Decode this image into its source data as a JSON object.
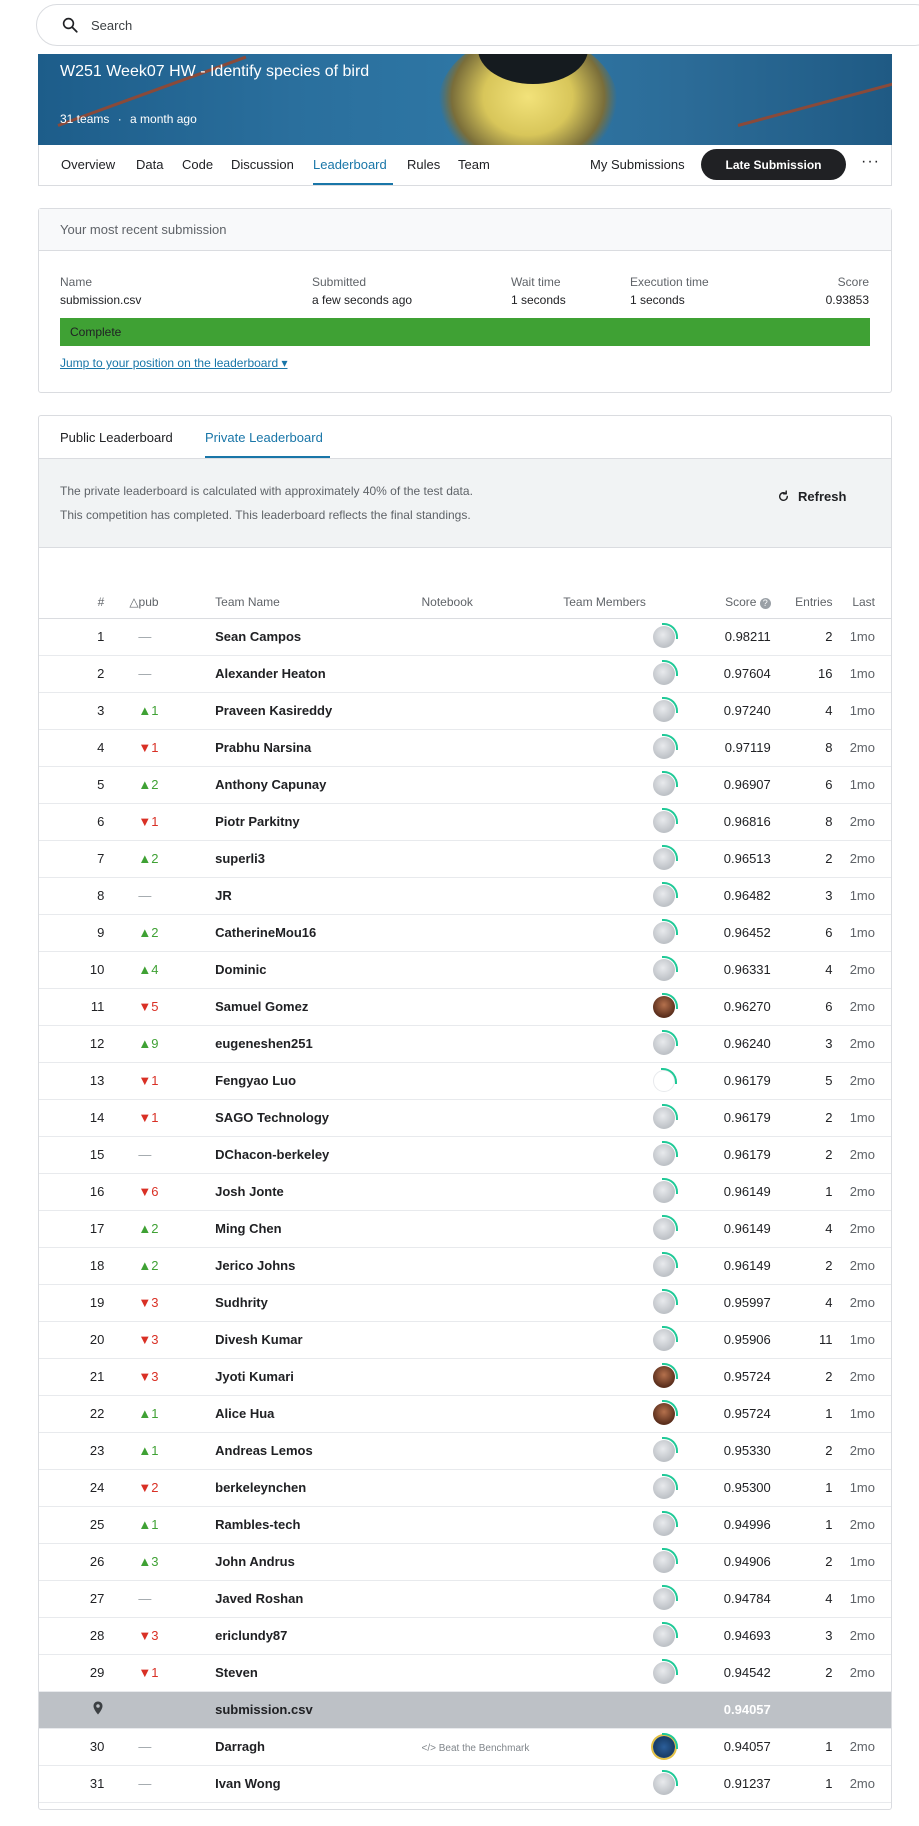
{
  "search": {
    "placeholder": "Search"
  },
  "competition": {
    "title": "W251 Week07 HW - Identify species of bird",
    "teams": "31 teams",
    "separator": "·",
    "age": "a month ago"
  },
  "nav": {
    "tabs": [
      "Overview",
      "Data",
      "Code",
      "Discussion",
      "Leaderboard",
      "Rules",
      "Team"
    ],
    "active": "Leaderboard",
    "my_submissions": "My Submissions",
    "late_submission": "Late Submission",
    "more": "···"
  },
  "submission": {
    "header": "Your most recent submission",
    "name_label": "Name",
    "name_value": "submission.csv",
    "submitted_label": "Submitted",
    "submitted_value": "a few seconds ago",
    "wait_label": "Wait time",
    "wait_value": "1 seconds",
    "exec_label": "Execution time",
    "exec_value": "1 seconds",
    "score_label": "Score",
    "score_value": "0.93853",
    "status": "Complete",
    "jump_link": "Jump to your position on the leaderboard ▾",
    "status_color": "#3fa134"
  },
  "leaderboard": {
    "tabs": [
      "Public Leaderboard",
      "Private Leaderboard"
    ],
    "active_tab": "Private Leaderboard",
    "info_line1": "The private leaderboard is calculated with approximately 40% of the test data.",
    "info_line2": "This competition has completed. This leaderboard reflects the final standings.",
    "refresh": "Refresh",
    "columns": [
      "#",
      "△pub",
      "Team Name",
      "Notebook",
      "Team Members",
      "Score",
      "Entries",
      "Last"
    ],
    "rows": [
      {
        "rank": "1",
        "dir": "flat",
        "delta": "—",
        "team": "Sean Campos",
        "score": "0.98211",
        "entries": "2",
        "last": "1mo"
      },
      {
        "rank": "2",
        "dir": "flat",
        "delta": "—",
        "team": "Alexander Heaton",
        "score": "0.97604",
        "entries": "16",
        "last": "1mo"
      },
      {
        "rank": "3",
        "dir": "up",
        "delta": "▲1",
        "team": "Praveen Kasireddy",
        "score": "0.97240",
        "entries": "4",
        "last": "1mo"
      },
      {
        "rank": "4",
        "dir": "down",
        "delta": "▼1",
        "team": "Prabhu Narsina",
        "score": "0.97119",
        "entries": "8",
        "last": "2mo"
      },
      {
        "rank": "5",
        "dir": "up",
        "delta": "▲2",
        "team": "Anthony Capunay",
        "score": "0.96907",
        "entries": "6",
        "last": "1mo"
      },
      {
        "rank": "6",
        "dir": "down",
        "delta": "▼1",
        "team": "Piotr Parkitny",
        "score": "0.96816",
        "entries": "8",
        "last": "2mo"
      },
      {
        "rank": "7",
        "dir": "up",
        "delta": "▲2",
        "team": "superli3",
        "score": "0.96513",
        "entries": "2",
        "last": "2mo"
      },
      {
        "rank": "8",
        "dir": "flat",
        "delta": "—",
        "team": "JR",
        "score": "0.96482",
        "entries": "3",
        "last": "1mo"
      },
      {
        "rank": "9",
        "dir": "up",
        "delta": "▲2",
        "team": "CatherineMou16",
        "score": "0.96452",
        "entries": "6",
        "last": "1mo"
      },
      {
        "rank": "10",
        "dir": "up",
        "delta": "▲4",
        "team": "Dominic",
        "score": "0.96331",
        "entries": "4",
        "last": "2mo"
      },
      {
        "rank": "11",
        "dir": "down",
        "delta": "▼5",
        "team": "Samuel Gomez",
        "score": "0.96270",
        "entries": "6",
        "last": "2mo",
        "avatar": "photo"
      },
      {
        "rank": "12",
        "dir": "up",
        "delta": "▲9",
        "team": "eugeneshen251",
        "score": "0.96240",
        "entries": "3",
        "last": "2mo"
      },
      {
        "rank": "13",
        "dir": "down",
        "delta": "▼1",
        "team": "Fengyao Luo",
        "score": "0.96179",
        "entries": "5",
        "last": "2mo",
        "avatar": "empty"
      },
      {
        "rank": "14",
        "dir": "down",
        "delta": "▼1",
        "team": "SAGO Technology",
        "score": "0.96179",
        "entries": "2",
        "last": "1mo"
      },
      {
        "rank": "15",
        "dir": "flat",
        "delta": "—",
        "team": "DChacon-berkeley",
        "score": "0.96179",
        "entries": "2",
        "last": "2mo"
      },
      {
        "rank": "16",
        "dir": "down",
        "delta": "▼6",
        "team": "Josh Jonte",
        "score": "0.96149",
        "entries": "1",
        "last": "2mo"
      },
      {
        "rank": "17",
        "dir": "up",
        "delta": "▲2",
        "team": "Ming Chen",
        "score": "0.96149",
        "entries": "4",
        "last": "2mo"
      },
      {
        "rank": "18",
        "dir": "up",
        "delta": "▲2",
        "team": "Jerico Johns",
        "score": "0.96149",
        "entries": "2",
        "last": "2mo"
      },
      {
        "rank": "19",
        "dir": "down",
        "delta": "▼3",
        "team": "Sudhrity",
        "score": "0.95997",
        "entries": "4",
        "last": "2mo"
      },
      {
        "rank": "20",
        "dir": "down",
        "delta": "▼3",
        "team": "Divesh Kumar",
        "score": "0.95906",
        "entries": "11",
        "last": "1mo"
      },
      {
        "rank": "21",
        "dir": "down",
        "delta": "▼3",
        "team": "Jyoti Kumari",
        "score": "0.95724",
        "entries": "2",
        "last": "2mo",
        "avatar": "photo"
      },
      {
        "rank": "22",
        "dir": "up",
        "delta": "▲1",
        "team": "Alice Hua",
        "score": "0.95724",
        "entries": "1",
        "last": "1mo",
        "avatar": "photo"
      },
      {
        "rank": "23",
        "dir": "up",
        "delta": "▲1",
        "team": "Andreas Lemos",
        "score": "0.95330",
        "entries": "2",
        "last": "2mo"
      },
      {
        "rank": "24",
        "dir": "down",
        "delta": "▼2",
        "team": "berkeleynchen",
        "score": "0.95300",
        "entries": "1",
        "last": "1mo"
      },
      {
        "rank": "25",
        "dir": "up",
        "delta": "▲1",
        "team": "Rambles-tech",
        "score": "0.94996",
        "entries": "1",
        "last": "2mo"
      },
      {
        "rank": "26",
        "dir": "up",
        "delta": "▲3",
        "team": "John Andrus",
        "score": "0.94906",
        "entries": "2",
        "last": "1mo"
      },
      {
        "rank": "27",
        "dir": "flat",
        "delta": "—",
        "team": "Javed Roshan",
        "score": "0.94784",
        "entries": "4",
        "last": "1mo"
      },
      {
        "rank": "28",
        "dir": "down",
        "delta": "▼3",
        "team": "ericlundy87",
        "score": "0.94693",
        "entries": "3",
        "last": "2mo"
      },
      {
        "rank": "29",
        "dir": "down",
        "delta": "▼1",
        "team": "Steven",
        "score": "0.94542",
        "entries": "2",
        "last": "2mo"
      },
      {
        "mine": true,
        "team": "submission.csv",
        "score": "0.94057"
      },
      {
        "rank": "30",
        "dir": "flat",
        "delta": "—",
        "team": "Darragh",
        "notebook": "</> Beat the Benchmark",
        "score": "0.94057",
        "entries": "1",
        "last": "2mo",
        "avatar": "gold"
      },
      {
        "rank": "31",
        "dir": "flat",
        "delta": "—",
        "team": "Ivan Wong",
        "score": "0.91237",
        "entries": "1",
        "last": "2mo"
      }
    ]
  },
  "colors": {
    "accent": "#1976a8",
    "up": "#3fa134",
    "down": "#d93025",
    "highlight_row": "#bdc1c6"
  }
}
